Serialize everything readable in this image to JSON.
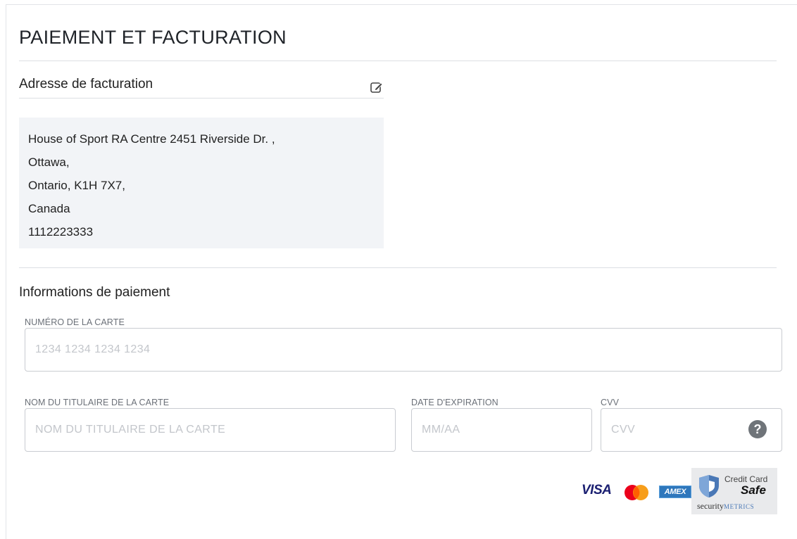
{
  "section": {
    "title": "PAIEMENT ET FACTURATION"
  },
  "billing": {
    "title": "Adresse de facturation",
    "edit_icon": "edit-icon",
    "address_lines": [
      "House of Sport RA Centre 2451 Riverside Dr. ,",
      "Ottawa,",
      "Ontario, K1H 7X7,",
      "Canada",
      "1112223333"
    ]
  },
  "payment": {
    "title": "Informations de paiement",
    "card_number": {
      "label": "NUMÉRO DE LA CARTE",
      "placeholder": "1234 1234 1234 1234",
      "value": ""
    },
    "holder_name": {
      "label": "NOM DU TITULAIRE DE LA CARTE",
      "placeholder": "NOM DU TITULAIRE DE LA CARTE",
      "value": ""
    },
    "expiry": {
      "label": "DATE D'EXPIRATION",
      "placeholder": "MM/AA",
      "value": ""
    },
    "cvv": {
      "label": "CVV",
      "placeholder": "CVV",
      "value": "",
      "help_icon": "question-circle-icon",
      "help_glyph": "?"
    }
  },
  "card_logos": {
    "visa": "VISA",
    "mastercard": "mastercard-logo",
    "amex": "AMEX"
  },
  "security_badge": {
    "line1": "Credit Card",
    "line2": "Safe",
    "brand_main": "security",
    "brand_suffix": "METRICS"
  },
  "colors": {
    "address_bg": "#f2f4f7",
    "border": "#c9ccd1",
    "visa_blue": "#1a1f71",
    "amex_blue": "#2e77bc"
  }
}
